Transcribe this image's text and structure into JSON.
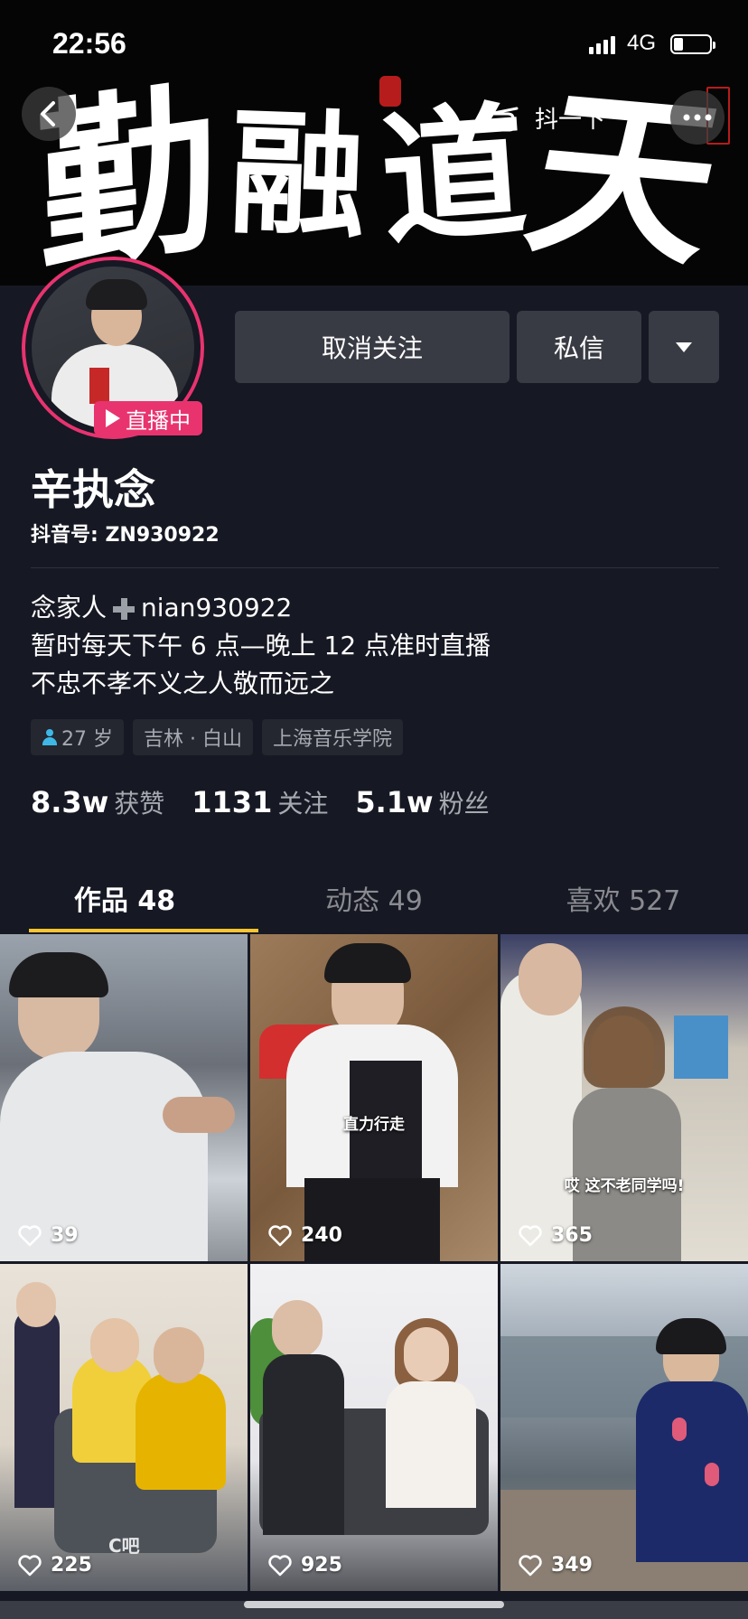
{
  "status_bar": {
    "time": "22:56",
    "network": "4G"
  },
  "banner": {
    "calligraphy": [
      "勤",
      "融",
      "道",
      "天"
    ],
    "dou_label": "抖一下"
  },
  "profile": {
    "live_badge": "直播中",
    "name": "辛执念",
    "douyin_id": "抖音号: ZN930922",
    "bio": {
      "line1_prefix": "念家人",
      "line1_suffix": "nian930922",
      "line2": "暂时每天下午 6 点—晚上 12 点准时直播",
      "line3": "不忠不孝不义之人敬而远之"
    },
    "tags": [
      "27 岁",
      "吉林 · 白山",
      "上海音乐学院"
    ]
  },
  "actions": {
    "unfollow": "取消关注",
    "message": "私信"
  },
  "stats": [
    {
      "num": "8.3w",
      "label": "获赞"
    },
    {
      "num": "1131",
      "label": "关注"
    },
    {
      "num": "5.1w",
      "label": "粉丝"
    }
  ],
  "tabs": [
    {
      "label": "作品 48",
      "active": true
    },
    {
      "label": "动态 49",
      "active": false
    },
    {
      "label": "喜欢 527",
      "active": false
    }
  ],
  "videos": [
    {
      "likes": "39",
      "caption": ""
    },
    {
      "likes": "240",
      "caption": "直力行走"
    },
    {
      "likes": "365",
      "caption": "哎 这不老同学吗!"
    },
    {
      "likes": "225",
      "caption": ""
    },
    {
      "likes": "925",
      "caption": ""
    },
    {
      "likes": "349",
      "caption": ""
    }
  ],
  "colors": {
    "background": "#161823",
    "live_pink": "#e8336f",
    "tab_indicator": "#fbc531",
    "button_bg": "#393b44"
  }
}
